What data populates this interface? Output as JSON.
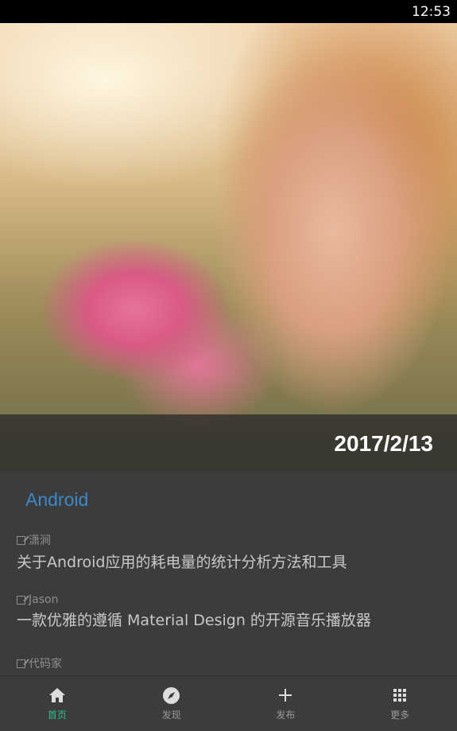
{
  "status": {
    "time": "12:53"
  },
  "hero": {
    "date": "2017/2/13"
  },
  "category": "Android",
  "articles": [
    {
      "author": "潇涧",
      "title": "关于Android应用的耗电量的统计分析方法和工具"
    },
    {
      "author": "Jason",
      "title": "一款优雅的遵循 Material Design 的开源音乐播放器"
    },
    {
      "author": "代码家",
      "title": ""
    }
  ],
  "nav": [
    {
      "label": "首页",
      "icon": "home-icon",
      "active": true
    },
    {
      "label": "发现",
      "icon": "compass-icon"
    },
    {
      "label": "发布",
      "icon": "plus-icon"
    },
    {
      "label": "更多",
      "icon": "grid-icon"
    }
  ],
  "colors": {
    "accent": "#2ebf8c",
    "category": "#3c88c8"
  }
}
